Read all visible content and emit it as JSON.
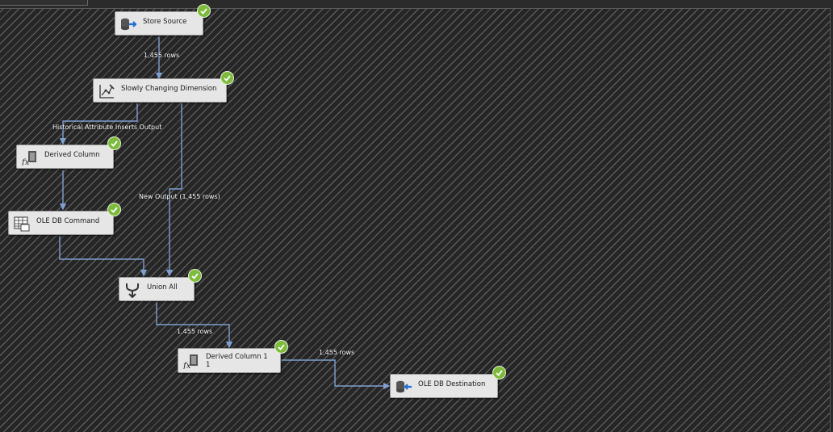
{
  "components": {
    "store_source": "Store Source",
    "scd": "Slowly Changing Dimension",
    "derived_column": "Derived Column",
    "ole_db_command": "OLE DB Command",
    "union_all": "Union All",
    "derived_column_1": "Derived Column 1\n1",
    "ole_db_destination": "OLE DB Destination"
  },
  "paths": {
    "source_to_scd": "1,455 rows",
    "historical_inserts": "Historical Attribute Inserts Output",
    "new_output": "New Output (1,455 rows)",
    "union_to_derived": "1,455 rows",
    "derived_to_dest": "1,455 rows"
  },
  "colors": {
    "path": "#7f9fd0",
    "success": "#7dbb3c",
    "node": "#e6e6e6"
  },
  "icons": {
    "source": "database-arrow-icon",
    "scd": "scd-chart-icon",
    "derived": "fx-icon",
    "command": "grid-icon",
    "union": "merge-icon",
    "destination": "database-arrow-in-icon",
    "status": "success-check-icon"
  }
}
